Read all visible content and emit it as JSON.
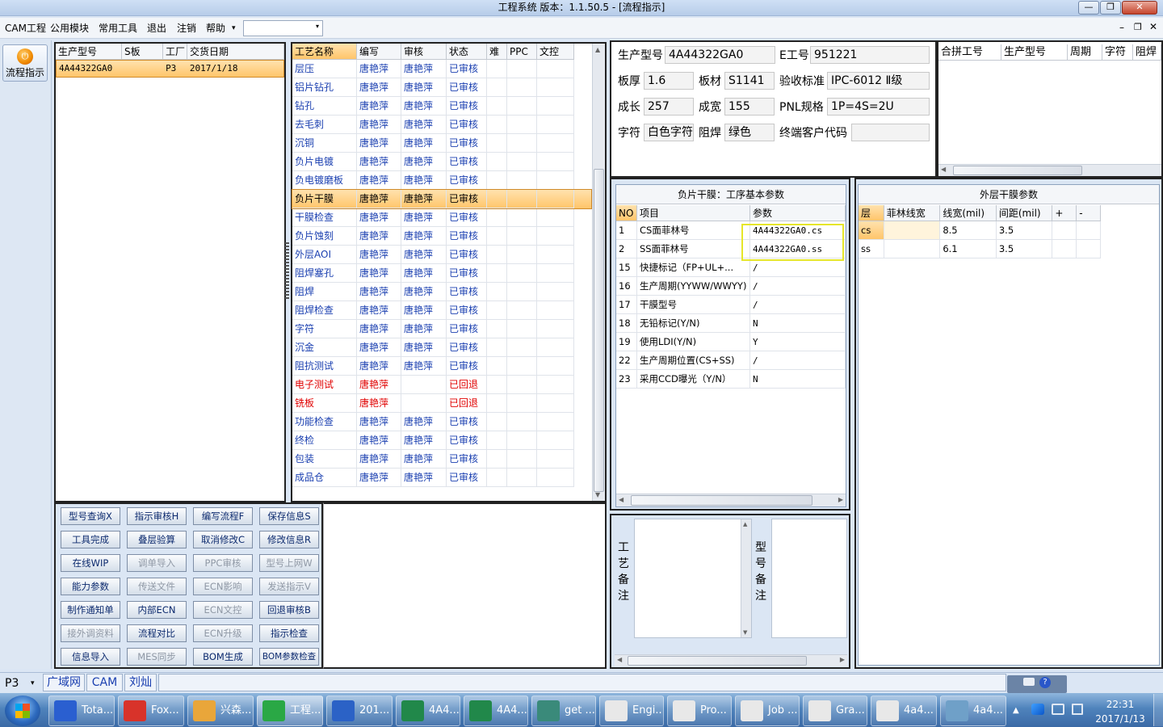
{
  "window": {
    "title": "工程系统   版本：1.1.50.5 - [流程指示]",
    "min": "—",
    "max": "❐",
    "close": "✕"
  },
  "menu": {
    "items": [
      "CAM工程",
      "公用模块",
      "常用工具",
      "退出",
      "注销",
      "帮助"
    ],
    "help_arrow": "▾",
    "combo_value": ""
  },
  "sidebar": {
    "flow_label": "流程指示"
  },
  "job_list": {
    "headers": [
      "生产型号",
      "S板",
      "工厂",
      "交货日期"
    ],
    "rows": [
      [
        "4A44322GA0",
        "",
        "P3",
        "2017/1/18"
      ]
    ]
  },
  "process": {
    "headers": [
      "工艺名称",
      "编写",
      "审核",
      "状态",
      "难",
      "PPC",
      "文控"
    ],
    "rows": [
      {
        "name": "层压",
        "writer": "唐艳萍",
        "reviewer": "唐艳萍",
        "status": "已审核",
        "red": false
      },
      {
        "name": "铝片钻孔",
        "writer": "唐艳萍",
        "reviewer": "唐艳萍",
        "status": "已审核",
        "red": false
      },
      {
        "name": "钻孔",
        "writer": "唐艳萍",
        "reviewer": "唐艳萍",
        "status": "已审核",
        "red": false
      },
      {
        "name": "去毛刺",
        "writer": "唐艳萍",
        "reviewer": "唐艳萍",
        "status": "已审核",
        "red": false
      },
      {
        "name": "沉铜",
        "writer": "唐艳萍",
        "reviewer": "唐艳萍",
        "status": "已审核",
        "red": false
      },
      {
        "name": "负片电镀",
        "writer": "唐艳萍",
        "reviewer": "唐艳萍",
        "status": "已审核",
        "red": false
      },
      {
        "name": "负电镀磨板",
        "writer": "唐艳萍",
        "reviewer": "唐艳萍",
        "status": "已审核",
        "red": false
      },
      {
        "name": "负片干膜",
        "writer": "唐艳萍",
        "reviewer": "唐艳萍",
        "status": "已审核",
        "red": false,
        "selected": true
      },
      {
        "name": "干膜检查",
        "writer": "唐艳萍",
        "reviewer": "唐艳萍",
        "status": "已审核",
        "red": false
      },
      {
        "name": "负片蚀刻",
        "writer": "唐艳萍",
        "reviewer": "唐艳萍",
        "status": "已审核",
        "red": false
      },
      {
        "name": "外层AOI",
        "writer": "唐艳萍",
        "reviewer": "唐艳萍",
        "status": "已审核",
        "red": false
      },
      {
        "name": "阻焊塞孔",
        "writer": "唐艳萍",
        "reviewer": "唐艳萍",
        "status": "已审核",
        "red": false
      },
      {
        "name": "阻焊",
        "writer": "唐艳萍",
        "reviewer": "唐艳萍",
        "status": "已审核",
        "red": false
      },
      {
        "name": "阻焊检查",
        "writer": "唐艳萍",
        "reviewer": "唐艳萍",
        "status": "已审核",
        "red": false
      },
      {
        "name": "字符",
        "writer": "唐艳萍",
        "reviewer": "唐艳萍",
        "status": "已审核",
        "red": false
      },
      {
        "name": "沉金",
        "writer": "唐艳萍",
        "reviewer": "唐艳萍",
        "status": "已审核",
        "red": false
      },
      {
        "name": "阻抗测试",
        "writer": "唐艳萍",
        "reviewer": "唐艳萍",
        "status": "已审核",
        "red": false
      },
      {
        "name": "电子测试",
        "writer": "唐艳萍",
        "reviewer": "",
        "status": "已回退",
        "red": true
      },
      {
        "name": "铣板",
        "writer": "唐艳萍",
        "reviewer": "",
        "status": "已回退",
        "red": true
      },
      {
        "name": "功能检查",
        "writer": "唐艳萍",
        "reviewer": "唐艳萍",
        "status": "已审核",
        "red": false
      },
      {
        "name": "终检",
        "writer": "唐艳萍",
        "reviewer": "唐艳萍",
        "status": "已审核",
        "red": false
      },
      {
        "name": "包装",
        "writer": "唐艳萍",
        "reviewer": "唐艳萍",
        "status": "已审核",
        "red": false
      },
      {
        "name": "成品仓",
        "writer": "唐艳萍",
        "reviewer": "唐艳萍",
        "status": "已审核",
        "red": false
      }
    ]
  },
  "buttons": [
    [
      {
        "label": "型号查询X",
        "enabled": true
      },
      {
        "label": "指示审核H",
        "enabled": true
      },
      {
        "label": "编写流程F",
        "enabled": true
      },
      {
        "label": "保存信息S",
        "enabled": true
      }
    ],
    [
      {
        "label": "工具完成",
        "enabled": true
      },
      {
        "label": "叠层验算",
        "enabled": true
      },
      {
        "label": "取消修改C",
        "enabled": true
      },
      {
        "label": "修改信息R",
        "enabled": true
      }
    ],
    [
      {
        "label": "在线WIP",
        "enabled": true
      },
      {
        "label": "调单导入",
        "enabled": false
      },
      {
        "label": "PPC审核",
        "enabled": false
      },
      {
        "label": "型号上网W",
        "enabled": false
      }
    ],
    [
      {
        "label": "能力参数",
        "enabled": true
      },
      {
        "label": "传送文件",
        "enabled": false
      },
      {
        "label": "ECN影响",
        "enabled": false
      },
      {
        "label": "发送指示V",
        "enabled": false
      }
    ],
    [
      {
        "label": "制作通知单",
        "enabled": true
      },
      {
        "label": "内部ECN",
        "enabled": true
      },
      {
        "label": "ECN文控",
        "enabled": false
      },
      {
        "label": "回退审核B",
        "enabled": true
      }
    ],
    [
      {
        "label": "接外调资料",
        "enabled": false
      },
      {
        "label": "流程对比",
        "enabled": true
      },
      {
        "label": "ECN升级",
        "enabled": false
      },
      {
        "label": "指示检查",
        "enabled": true
      }
    ],
    [
      {
        "label": "信息导入",
        "enabled": true
      },
      {
        "label": "MES同步",
        "enabled": false
      },
      {
        "label": "BOM生成",
        "enabled": true
      },
      {
        "label": "BOM参数检查",
        "enabled": true
      }
    ]
  ],
  "info": {
    "model_label": "生产型号",
    "model_value": "4A44322GA0",
    "ejob_label": "E工号",
    "ejob_value": "951221",
    "thick_label": "板厚",
    "thick_value": "1.6",
    "material_label": "板材",
    "material_value": "S1141",
    "accept_label": "验收标准",
    "accept_value": "IPC-6012 Ⅱ级",
    "length_label": "成长",
    "length_value": "257",
    "width_label": "成宽",
    "width_value": "155",
    "pnl_label": "PNL规格",
    "pnl_value": "1P=4S=2U",
    "char_label": "字符",
    "char_value": "白色字符",
    "mask_label": "阻焊",
    "mask_value": "绿色",
    "customer_label": "终端客户代码",
    "customer_value": ""
  },
  "merge": {
    "headers": [
      "合拼工号",
      "生产型号",
      "周期",
      "字符",
      "阻焊"
    ]
  },
  "params": {
    "title": "负片干膜：工序基本参数",
    "headers": [
      "NO",
      "项目",
      "参数"
    ],
    "rows": [
      [
        "1",
        "CS面菲林号",
        "4A44322GA0.cs"
      ],
      [
        "2",
        "SS面菲林号",
        "4A44322GA0.ss"
      ],
      [
        "15",
        "快捷标记（FP+UL+...",
        "/"
      ],
      [
        "16",
        "生产周期(YYWW/WWYY)",
        "/"
      ],
      [
        "17",
        "干膜型号",
        "/"
      ],
      [
        "18",
        "无铅标记(Y/N)",
        "N"
      ],
      [
        "19",
        "使用LDI(Y/N)",
        "Y"
      ],
      [
        "22",
        "生产周期位置(CS+SS)",
        "/"
      ],
      [
        "23",
        "采用CCD曝光（Y/N）",
        "N"
      ]
    ]
  },
  "outer": {
    "title": "外层干膜参数",
    "headers": [
      "层",
      "菲林线宽",
      "线宽(mil)",
      "间距(mil)",
      "+",
      "-"
    ],
    "rows": [
      [
        "cs",
        "",
        "8.5",
        "3.5",
        "",
        ""
      ],
      [
        "ss",
        "",
        "6.1",
        "3.5",
        "",
        ""
      ]
    ]
  },
  "notes": {
    "process_label": "工艺备注",
    "model_label": "型号备注"
  },
  "status": {
    "factory": "P3",
    "links": [
      "广域网",
      "CAM",
      "刘灿"
    ]
  },
  "taskbar": {
    "items": [
      "Tota...",
      "Fox...",
      "兴森...",
      "工程...",
      "201...",
      "4A4...",
      "4A4...",
      "get ...",
      "Engi...",
      "Pro...",
      "Job ...",
      "Gra...",
      "4a4...",
      "4a4..."
    ],
    "time": "22:31",
    "date": "2017/1/13"
  },
  "colors": {
    "accent": "#ffc56a",
    "highlight_box": "#e6e62a",
    "link": "#1a3fb0",
    "error": "#e00000"
  }
}
